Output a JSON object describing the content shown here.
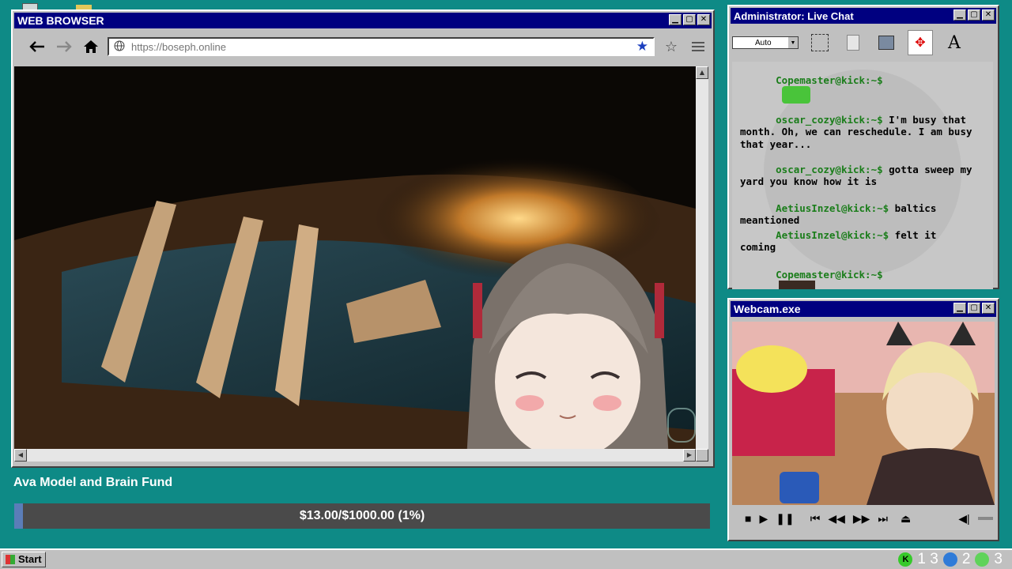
{
  "browser": {
    "title": "WEB BROWSER",
    "url_placeholder": "https://boseph.online",
    "controls": {
      "back": "🡐",
      "forward": "🡒",
      "home": "⌂"
    }
  },
  "chat": {
    "title": "Administrator: Live Chat",
    "font_select": "Auto",
    "text_tool": "A",
    "messages": [
      {
        "user": "Copemaster@kick:~$",
        "text": ""
      },
      {
        "user": "oscar_cozy@kick:~$",
        "text": " I'm busy that month. Oh, we can reschedule. I am busy that year..."
      },
      {
        "user": "oscar_cozy@kick:~$",
        "text": " gotta sweep my yard you know how it is"
      },
      {
        "user": "AetiusInzel@kick:~$",
        "text": " baltics meantioned"
      },
      {
        "user": "AetiusInzel@kick:~$",
        "text": " felt it coming"
      },
      {
        "user": "Copemaster@kick:~$",
        "text": ""
      }
    ]
  },
  "webcam": {
    "title": "Webcam.exe"
  },
  "fund": {
    "label": "Ava Model and Brain Fund",
    "progress_text": "$13.00/$1000.00 (1%)",
    "progress_fraction": 0.013
  },
  "taskbar": {
    "start_label": "Start",
    "tray": {
      "kick_count": "1 3",
      "moon_count": "2",
      "play_count": "3"
    }
  },
  "colors": {
    "desktop": "#0e8a86",
    "titlebar": "#000080",
    "chat_user": "#1a7d1a",
    "fund_bar": "#4a4a4a"
  }
}
